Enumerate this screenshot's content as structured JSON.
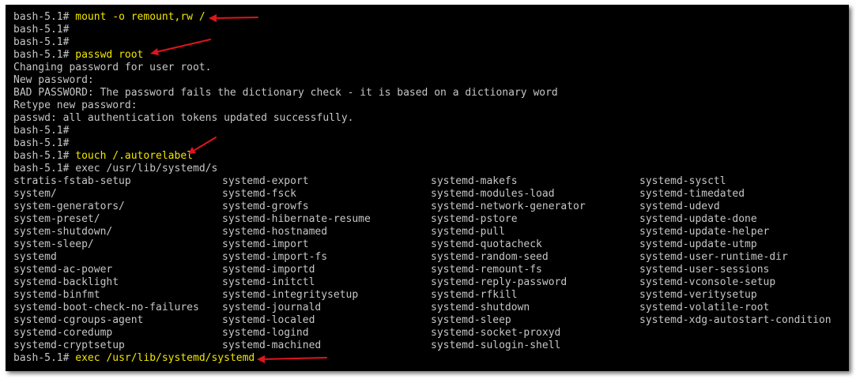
{
  "terminal": {
    "prompt": "bash-5.1# ",
    "lines": [
      {
        "prompt": "bash-5.1# ",
        "cmd": "mount -o remount,rw /",
        "out": ""
      },
      {
        "prompt": "bash-5.1#",
        "cmd": "",
        "out": ""
      },
      {
        "prompt": "bash-5.1#",
        "cmd": "",
        "out": ""
      },
      {
        "prompt": "bash-5.1# ",
        "cmd": "passwd root",
        "out": ""
      },
      {
        "prompt": "",
        "cmd": "",
        "out": "Changing password for user root."
      },
      {
        "prompt": "",
        "cmd": "",
        "out": "New password:"
      },
      {
        "prompt": "",
        "cmd": "",
        "out": "BAD PASSWORD: The password fails the dictionary check - it is based on a dictionary word"
      },
      {
        "prompt": "",
        "cmd": "",
        "out": "Retype new password:"
      },
      {
        "prompt": "",
        "cmd": "",
        "out": "passwd: all authentication tokens updated successfully."
      },
      {
        "prompt": "bash-5.1#",
        "cmd": "",
        "out": ""
      },
      {
        "prompt": "bash-5.1#",
        "cmd": "",
        "out": ""
      },
      {
        "prompt": "bash-5.1# ",
        "cmd": "touch /.autorelabel",
        "out": ""
      },
      {
        "prompt": "bash-5.1# ",
        "cmd": "",
        "out": "exec /usr/lib/systemd/s"
      }
    ],
    "completions": [
      [
        "stratis-fstab-setup",
        "systemd-export",
        "systemd-makefs",
        "systemd-sysctl"
      ],
      [
        "system/",
        "systemd-fsck",
        "systemd-modules-load",
        "systemd-timedated"
      ],
      [
        "system-generators/",
        "systemd-growfs",
        "systemd-network-generator",
        "systemd-udevd"
      ],
      [
        "system-preset/",
        "systemd-hibernate-resume",
        "systemd-pstore",
        "systemd-update-done"
      ],
      [
        "system-shutdown/",
        "systemd-hostnamed",
        "systemd-pull",
        "systemd-update-helper"
      ],
      [
        "system-sleep/",
        "systemd-import",
        "systemd-quotacheck",
        "systemd-update-utmp"
      ],
      [
        "systemd",
        "systemd-import-fs",
        "systemd-random-seed",
        "systemd-user-runtime-dir"
      ],
      [
        "systemd-ac-power",
        "systemd-importd",
        "systemd-remount-fs",
        "systemd-user-sessions"
      ],
      [
        "systemd-backlight",
        "systemd-initctl",
        "systemd-reply-password",
        "systemd-vconsole-setup"
      ],
      [
        "systemd-binfmt",
        "systemd-integritysetup",
        "systemd-rfkill",
        "systemd-veritysetup"
      ],
      [
        "systemd-boot-check-no-failures",
        "systemd-journald",
        "systemd-shutdown",
        "systemd-volatile-root"
      ],
      [
        "systemd-cgroups-agent",
        "systemd-localed",
        "systemd-sleep",
        "systemd-xdg-autostart-condition"
      ],
      [
        "systemd-coredump",
        "systemd-logind",
        "systemd-socket-proxyd",
        ""
      ],
      [
        "systemd-cryptsetup",
        "systemd-machined",
        "systemd-sulogin-shell",
        ""
      ]
    ],
    "final_line": {
      "prompt": "bash-5.1# ",
      "cmd": "exec /usr/lib/systemd/systemd"
    }
  },
  "colors": {
    "background": "#000000",
    "text": "#c6c6c6",
    "command": "#f2e600",
    "arrow": "#e0141e"
  }
}
